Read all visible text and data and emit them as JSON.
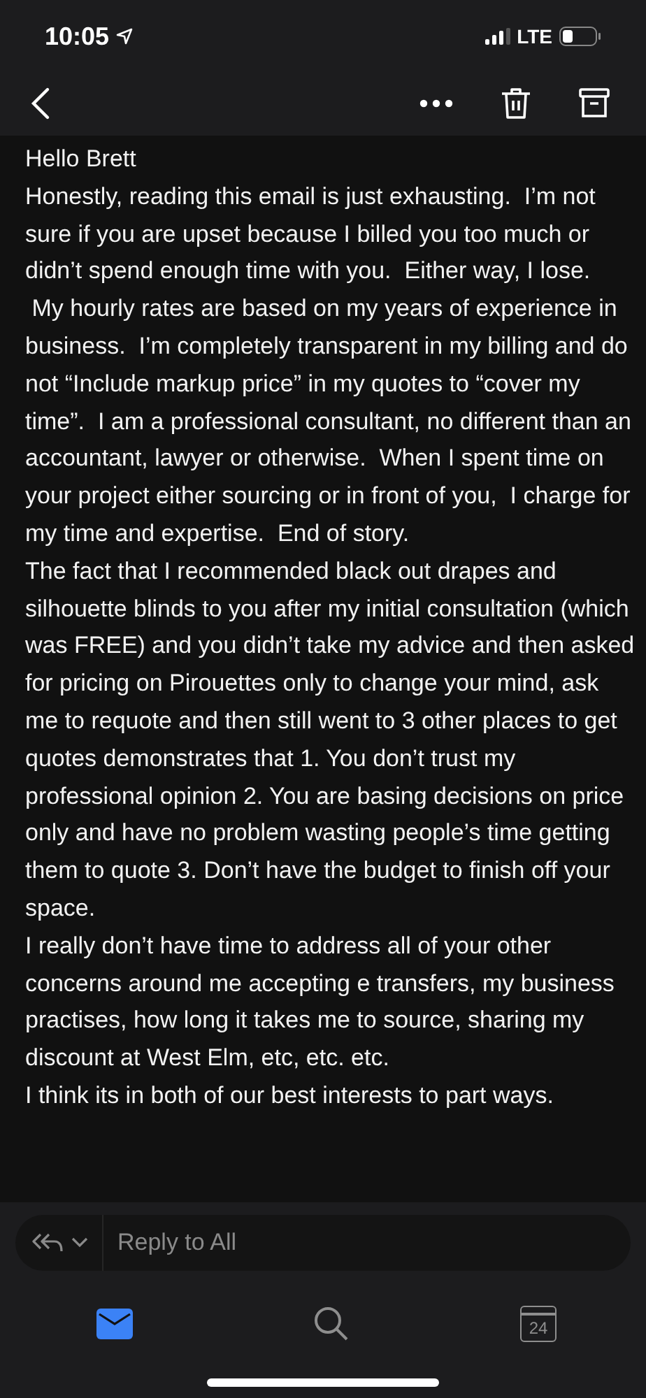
{
  "status_bar": {
    "time": "10:05",
    "network": "LTE"
  },
  "body": {
    "paragraphs": [
      "Hello Brett",
      "Honestly, reading this email is just exhausting.  I’m not sure if you are upset because I billed you too much or didn’t spend enough time with you.  Either way, I lose.",
      " My hourly rates are based on my years of experience in business.  I’m completely transparent in my billing and do not “Include markup price” in my quotes to “cover my time”.  I am a professional consultant, no different than an accountant, lawyer or otherwise.  When I spent time on your project either sourcing or in front of you,  I charge for my time and expertise.  End of story.",
      "The fact that I recommended black out drapes and silhouette blinds to you after my initial consultation (which was FREE) and you didn’t take my advice and then asked for pricing on Pirouettes only to change your mind, ask me to requote and then still went to 3 other places to get quotes demonstrates that 1. You don’t trust my professional opinion 2. You are basing decisions on price only and have no problem wasting people’s time getting them to quote 3. Don’t have the budget to finish off your space.",
      "I really don’t have time to address all of your other concerns around me accepting e transfers, my business practises, how long it takes me to source, sharing my discount at West Elm, etc, etc. etc.",
      "I think its in both of our best interests to part ways."
    ]
  },
  "reply": {
    "placeholder": "Reply to All"
  },
  "tabs": [
    {
      "kind": "mail",
      "selected": true
    },
    {
      "kind": "search",
      "selected": false
    },
    {
      "kind": "calendar",
      "label": "24",
      "selected": false
    }
  ]
}
